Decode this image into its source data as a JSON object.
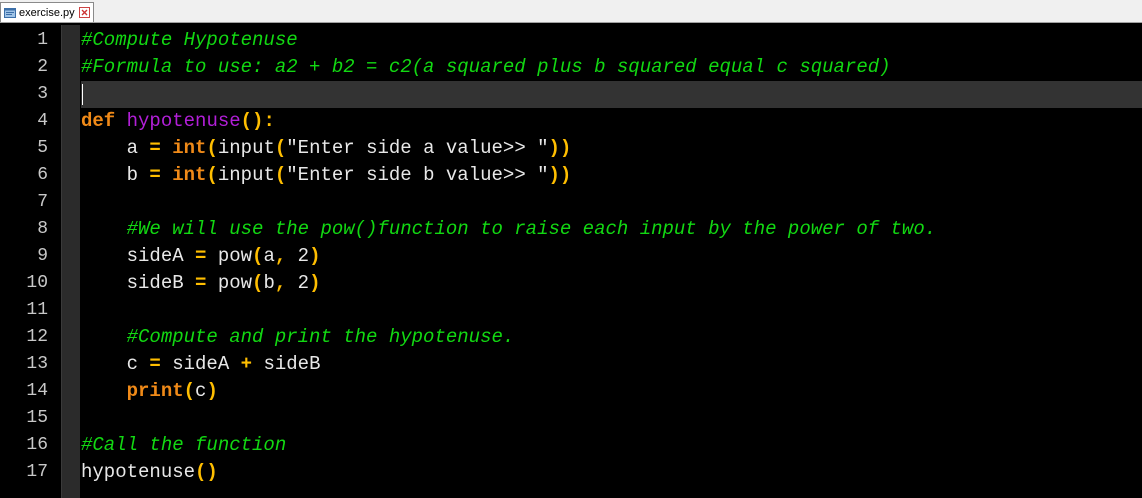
{
  "tab": {
    "filename": "exercise.py",
    "icon": "python-file-icon",
    "close_icon": "close-icon"
  },
  "colors": {
    "background": "#000000",
    "comment": "#12d812",
    "keyword": "#f08a18",
    "function_name": "#b21fd8",
    "operator": "#ffbe00",
    "text": "#e8e8e8",
    "line_number": "#c8c8c8",
    "current_line": "#333333"
  },
  "line_numbers": [
    "1",
    "2",
    "3",
    "4",
    "5",
    "6",
    "7",
    "8",
    "9",
    "10",
    "11",
    "12",
    "13",
    "14",
    "15",
    "16",
    "17"
  ],
  "current_line": 3,
  "lines": [
    [
      {
        "t": "comment",
        "v": "#Compute Hypotenuse"
      }
    ],
    [
      {
        "t": "comment",
        "v": "#Formula to use: a2 + b2 = c2(a squared plus b squared equal c squared)"
      }
    ],
    [],
    [
      {
        "t": "keyword",
        "v": "def"
      },
      {
        "t": "ident",
        "v": " "
      },
      {
        "t": "func",
        "v": "hypotenuse"
      },
      {
        "t": "paren",
        "v": "():"
      }
    ],
    [
      {
        "t": "ident",
        "v": "    a "
      },
      {
        "t": "op",
        "v": "="
      },
      {
        "t": "ident",
        "v": " "
      },
      {
        "t": "bkw",
        "v": "int"
      },
      {
        "t": "paren",
        "v": "("
      },
      {
        "t": "builtin",
        "v": "input"
      },
      {
        "t": "paren",
        "v": "("
      },
      {
        "t": "string",
        "v": "\"Enter side a value>> \""
      },
      {
        "t": "paren",
        "v": "))"
      }
    ],
    [
      {
        "t": "ident",
        "v": "    b "
      },
      {
        "t": "op",
        "v": "="
      },
      {
        "t": "ident",
        "v": " "
      },
      {
        "t": "bkw",
        "v": "int"
      },
      {
        "t": "paren",
        "v": "("
      },
      {
        "t": "builtin",
        "v": "input"
      },
      {
        "t": "paren",
        "v": "("
      },
      {
        "t": "string",
        "v": "\"Enter side b value>> \""
      },
      {
        "t": "paren",
        "v": "))"
      }
    ],
    [],
    [
      {
        "t": "ident",
        "v": "    "
      },
      {
        "t": "comment",
        "v": "#We will use the pow()function to raise each input by the power of two."
      }
    ],
    [
      {
        "t": "ident",
        "v": "    sideA "
      },
      {
        "t": "op",
        "v": "="
      },
      {
        "t": "ident",
        "v": " pow"
      },
      {
        "t": "paren",
        "v": "("
      },
      {
        "t": "ident",
        "v": "a"
      },
      {
        "t": "op",
        "v": ","
      },
      {
        "t": "number",
        "v": " 2"
      },
      {
        "t": "paren",
        "v": ")"
      }
    ],
    [
      {
        "t": "ident",
        "v": "    sideB "
      },
      {
        "t": "op",
        "v": "="
      },
      {
        "t": "ident",
        "v": " pow"
      },
      {
        "t": "paren",
        "v": "("
      },
      {
        "t": "ident",
        "v": "b"
      },
      {
        "t": "op",
        "v": ","
      },
      {
        "t": "number",
        "v": " 2"
      },
      {
        "t": "paren",
        "v": ")"
      }
    ],
    [],
    [
      {
        "t": "ident",
        "v": "    "
      },
      {
        "t": "comment",
        "v": "#Compute and print the hypotenuse."
      }
    ],
    [
      {
        "t": "ident",
        "v": "    c "
      },
      {
        "t": "op",
        "v": "="
      },
      {
        "t": "ident",
        "v": " sideA "
      },
      {
        "t": "op",
        "v": "+"
      },
      {
        "t": "ident",
        "v": " sideB"
      }
    ],
    [
      {
        "t": "ident",
        "v": "    "
      },
      {
        "t": "bkw",
        "v": "print"
      },
      {
        "t": "paren",
        "v": "("
      },
      {
        "t": "ident",
        "v": "c"
      },
      {
        "t": "paren",
        "v": ")"
      }
    ],
    [],
    [
      {
        "t": "comment",
        "v": "#Call the function"
      }
    ],
    [
      {
        "t": "ident",
        "v": "hypotenuse"
      },
      {
        "t": "paren",
        "v": "()"
      }
    ]
  ]
}
